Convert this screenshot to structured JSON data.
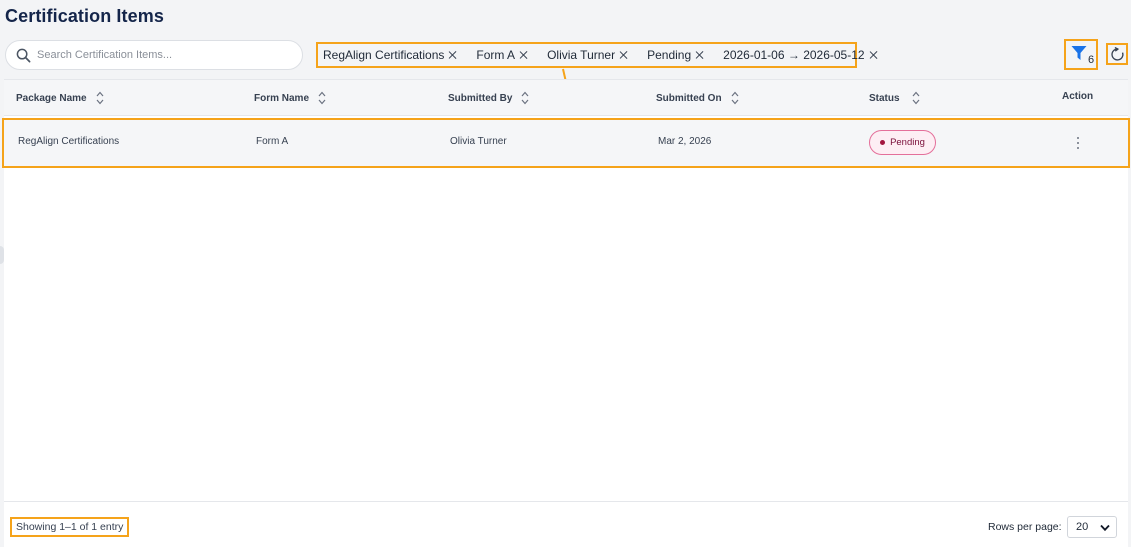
{
  "page": {
    "title": "Certification Items"
  },
  "search": {
    "placeholder": "Search Certification Items..."
  },
  "filters": {
    "chips": [
      {
        "label": "RegAlign Certifications"
      },
      {
        "label": "Form A"
      },
      {
        "label": "Olivia Turner"
      },
      {
        "label": "Pending"
      },
      {
        "label": "2026-01-06 → 2026-05-12"
      }
    ],
    "count": "6",
    "icon": "filter-icon"
  },
  "refresh": {
    "icon": "refresh-icon"
  },
  "table": {
    "columns": [
      {
        "label": "Package Name"
      },
      {
        "label": "Form Name"
      },
      {
        "label": "Submitted By"
      },
      {
        "label": "Submitted On"
      },
      {
        "label": "Status"
      },
      {
        "label": "Action"
      }
    ],
    "rows": [
      {
        "package": "RegAlign Certifications",
        "form": "Form A",
        "submitted_by": "Olivia Turner",
        "submitted_on": "Mar 2, 2026",
        "status": "Pending"
      }
    ]
  },
  "footer": {
    "showing": "Showing 1–1 of 1 entry",
    "rows_per_page_label": "Rows per page:",
    "rows_per_page_value": "20"
  },
  "colors": {
    "highlight": "#f5a31a",
    "title": "#14254a",
    "accent_blue": "#1a73e8",
    "pending_badge_border": "#e46f9a",
    "pending_badge_bg": "#fdeef4"
  }
}
